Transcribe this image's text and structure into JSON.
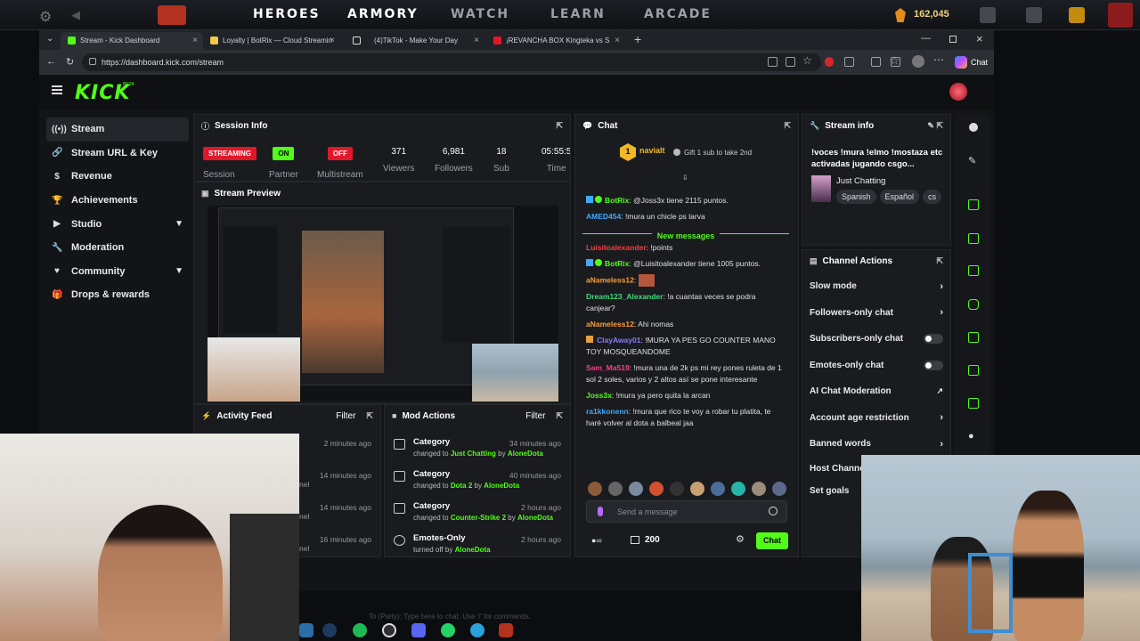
{
  "dota": {
    "nav": [
      "HEROES",
      "ARMORY",
      "WATCH",
      "LEARN",
      "ARCADE"
    ],
    "shards": "162,045"
  },
  "browser": {
    "tabs": [
      {
        "title": "Stream - Kick Dashboard"
      },
      {
        "title": "Loyalty | BotRix — Cloud Streamin"
      },
      {
        "title": "(4)TikTok - Make Your Day"
      },
      {
        "title": "¡REVANCHA BOX Kingteka vs S"
      }
    ],
    "url": "https://dashboard.kick.com/stream",
    "copilot": "Chat"
  },
  "sidebar": {
    "items": [
      {
        "label": "Stream",
        "icon": "broadcast-icon"
      },
      {
        "label": "Stream URL & Key",
        "icon": "link-icon"
      },
      {
        "label": "Revenue",
        "icon": "dollar-icon"
      },
      {
        "label": "Achievements",
        "icon": "trophy-icon"
      },
      {
        "label": "Studio",
        "icon": "video-icon"
      },
      {
        "label": "Moderation",
        "icon": "wrench-icon"
      },
      {
        "label": "Community",
        "icon": "heart-icon"
      },
      {
        "label": "Drops & rewards",
        "icon": "gift-icon"
      }
    ]
  },
  "session": {
    "title": "Session Info",
    "streaming": "STREAMING",
    "session_label": "Session",
    "on": "ON",
    "partner": "Partner",
    "off": "OFF",
    "multistream": "Multistream",
    "viewers": "371",
    "viewers_label": "Viewers",
    "followers": "6,981",
    "followers_label": "Followers",
    "subs": "18",
    "subs_label": "Sub",
    "time": "05:55:5",
    "time_label": "Time"
  },
  "preview": {
    "title": "Stream Preview"
  },
  "activity": {
    "title": "Activity Feed",
    "filter": "Filter",
    "times": [
      "2 minutes ago",
      "14 minutes ago",
      "14 minutes ago",
      "16 minutes ago"
    ],
    "snip": "nel"
  },
  "mod_actions": {
    "title": "Mod Actions",
    "filter": "Filter",
    "rows": [
      {
        "title": "Category",
        "pre": "changed to ",
        "what": "Just Chatting",
        "by": " by ",
        "who": "AloneDota",
        "time": "34 minutes ago"
      },
      {
        "title": "Category",
        "pre": "changed to ",
        "what": "Dota 2",
        "by": " by ",
        "who": "AloneDota",
        "time": "40 minutes ago"
      },
      {
        "title": "Category",
        "pre": "changed to ",
        "what": "Counter-Strike 2",
        "by": " by ",
        "who": "AloneDota",
        "time": "2 hours ago"
      },
      {
        "title": "Emotes-Only",
        "pre": "turned off by ",
        "what": "",
        "by": "",
        "who": "AloneDota",
        "time": "2 hours ago"
      }
    ]
  },
  "chat": {
    "title": "Chat",
    "pinned_user": "navialt",
    "pinned_count": "1",
    "gift_text": "Gift 1 sub to take 2nd",
    "new_messages": "New messages",
    "messages": [
      {
        "user": "BotRix",
        "text": ": @Joss3x tiene 2115 puntos.",
        "color": "#53fc18"
      },
      {
        "user": "AMED454",
        "text": ": !mura un chicle ps larva",
        "color": "#3fa9ff"
      },
      {
        "user": "Luisitoalexander",
        "text": ": !points",
        "color": "#ff3b3b"
      },
      {
        "user": "BotRix",
        "text": ": @Luisitoalexander tiene 1005 puntos.",
        "color": "#53fc18"
      },
      {
        "user": "aNameless12",
        "text": ":",
        "color": "#ff9d2f"
      },
      {
        "user": "Dream123_Alexander",
        "text": ": !a cuantas veces se podra canjear?",
        "color": "#3fdc7a"
      },
      {
        "user": "aNameless12",
        "text": ": Ahi nomas",
        "color": "#ff9d2f"
      },
      {
        "user": "ClayAway01",
        "text": ": !MURA YA PES GO COUNTER MANO TOY MOSQUEANDOME",
        "color": "#8a7bff"
      },
      {
        "user": "Sam_Ma519",
        "text": ": !mura una de 2k ps mi rey pones ruleta de 1 sol 2 soles, varios y 2 altos así se pone interesante",
        "color": "#ff3b8a"
      },
      {
        "user": "Joss3x",
        "text": ": !mura ya pero quita la arcan",
        "color": "#53fc18"
      },
      {
        "user": "ra1kkonenn",
        "text": ": !mura que rico te voy a robar tu platita, te haré volver al dota a balbeal jaa",
        "color": "#3fa9ff"
      }
    ],
    "placeholder": "Send a message",
    "points": "200",
    "send": "Chat"
  },
  "stream_info": {
    "title": "Stream info",
    "stream_title": "!voces !mura !elmo !mostaza etc activadas jugando csgo...",
    "category": "Just Chatting",
    "tags": [
      "Spanish",
      "Español",
      "cs"
    ]
  },
  "channel_actions": {
    "title": "Channel Actions",
    "rows": [
      {
        "label": "Slow mode",
        "kind": "arrow"
      },
      {
        "label": "Followers-only chat",
        "kind": "arrow"
      },
      {
        "label": "Subscribers-only chat",
        "kind": "toggle"
      },
      {
        "label": "Emotes-only chat",
        "kind": "toggle"
      },
      {
        "label": "AI Chat Moderation",
        "kind": "external"
      },
      {
        "label": "Account age restriction",
        "kind": "arrow"
      },
      {
        "label": "Banned words",
        "kind": "arrow"
      },
      {
        "label": "Host Channel",
        "kind": "none"
      },
      {
        "label": "Set goals",
        "kind": "none"
      }
    ]
  },
  "chat_bottom": {
    "text": "To (Party): Type here to chat. Use '/' for commands."
  },
  "colors": {
    "kick_green": "#53fc18",
    "live_red": "#e1182a",
    "bg": "#0b0d10"
  }
}
